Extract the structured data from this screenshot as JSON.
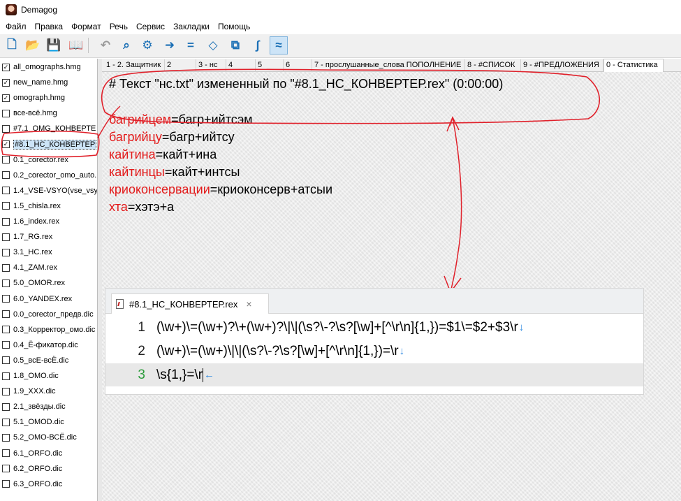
{
  "window": {
    "title": "Demagog"
  },
  "menu": [
    "Файл",
    "Правка",
    "Формат",
    "Речь",
    "Сервис",
    "Закладки",
    "Помощь"
  ],
  "toolbar": {
    "buttons": [
      {
        "name": "new-file-icon",
        "glyph": "🗋"
      },
      {
        "name": "open-folder-icon",
        "glyph": "📂"
      },
      {
        "name": "save-icon",
        "glyph": "💾"
      },
      {
        "name": "book-icon",
        "glyph": "📖"
      },
      {
        "name": "undo-icon",
        "glyph": "↶"
      },
      {
        "name": "binoculars-icon",
        "glyph": "⌕"
      },
      {
        "name": "gear-icon",
        "glyph": "⚙"
      },
      {
        "name": "arrow-right-icon",
        "glyph": "➜"
      },
      {
        "name": "equals-icon",
        "glyph": "="
      },
      {
        "name": "diamond-icon",
        "glyph": "◇"
      },
      {
        "name": "convert-icon",
        "glyph": "⧉"
      },
      {
        "name": "integral-icon",
        "glyph": "∫"
      },
      {
        "name": "approx-icon",
        "glyph": "≈"
      }
    ]
  },
  "sidebar": {
    "items": [
      {
        "label": "all_omographs.hmg",
        "checked": true
      },
      {
        "label": "new_name.hmg",
        "checked": true
      },
      {
        "label": "omograph.hmg",
        "checked": true
      },
      {
        "label": "все-всё.hmg",
        "checked": false
      },
      {
        "label": "#7.1_OMG_КОНВЕРТЕ",
        "checked": false
      },
      {
        "label": "#8.1_НС_КОНВЕРТЕР",
        "checked": true,
        "selected": true
      },
      {
        "label": "0.1_corector.rex",
        "checked": false
      },
      {
        "label": "0.2_corector_omo_auto.",
        "checked": false
      },
      {
        "label": "1.4_VSE-VSYO(vse_vsy",
        "checked": false
      },
      {
        "label": "1.5_chisla.rex",
        "checked": false
      },
      {
        "label": "1.6_index.rex",
        "checked": false
      },
      {
        "label": "1.7_RG.rex",
        "checked": false
      },
      {
        "label": "3.1_НС.rex",
        "checked": false
      },
      {
        "label": "4.1_ZAM.rex",
        "checked": false
      },
      {
        "label": "5.0_OMOR.rex",
        "checked": false
      },
      {
        "label": "6.0_YANDEX.rex",
        "checked": false
      },
      {
        "label": "0.0_corector_предв.dic",
        "checked": false
      },
      {
        "label": "0.3_Корректор_омо.dic",
        "checked": false
      },
      {
        "label": "0.4_Ё-фикатор.dic",
        "checked": false
      },
      {
        "label": "0.5_всЕ-всЁ.dic",
        "checked": false
      },
      {
        "label": "1.8_OMO.dic",
        "checked": false
      },
      {
        "label": "1.9_XXX.dic",
        "checked": false
      },
      {
        "label": "2.1_звёзды.dic",
        "checked": false
      },
      {
        "label": "5.1_OMOD.dic",
        "checked": false
      },
      {
        "label": "5.2_OMO-ВСЁ.dic",
        "checked": false
      },
      {
        "label": "6.1_ORFO.dic",
        "checked": false
      },
      {
        "label": "6.2_ORFO.dic",
        "checked": false
      },
      {
        "label": "6.3_ORFO.dic",
        "checked": false
      }
    ]
  },
  "tabs": [
    {
      "label": "1 - 2. Защитник"
    },
    {
      "label": "2"
    },
    {
      "label": "3 - нс"
    },
    {
      "label": "4"
    },
    {
      "label": "5"
    },
    {
      "label": "6"
    },
    {
      "label": "7 - прослушанные_слова ПОПОЛНЕНИЕ"
    },
    {
      "label": "8 - #СПИСОК"
    },
    {
      "label": "9 - #ПРЕДЛОЖЕНИЯ"
    },
    {
      "label": "0 - Статистика",
      "active": true
    }
  ],
  "report": {
    "header": "# Текст \"нс.txt\" измененный по \"#8.1_НС_КОНВЕРТЕР.rex\" (0:00:00)",
    "entries": [
      {
        "word": "багрийцем",
        "rest": "=багр+ийтсэм"
      },
      {
        "word": "багрийцу",
        "rest": "=багр+ийтсу"
      },
      {
        "word": "кайтина",
        "rest": "=кайт+ина"
      },
      {
        "word": "кайтинцы",
        "rest": "=кайт+интсы"
      },
      {
        "word": "криоконсервации",
        "rest": "=криоконсерв+атсыи"
      },
      {
        "word": "хта",
        "rest": "=хэтэ+а"
      }
    ]
  },
  "editor": {
    "tab_label": "#8.1_НС_КОНВЕРТЕР.rex",
    "close_glyph": "×",
    "lines": [
      {
        "num": "1",
        "code": "(\\w+)\\=(\\w+)?\\+(\\w+)?\\|\\|(\\s?\\-?\\s?[\\w]+[^\\r\\n]{1,})=$1\\=$2+$3\\r",
        "eol": "↓"
      },
      {
        "num": "2",
        "code": "(\\w+)\\=(\\w+)\\|\\|(\\s?\\-?\\s?[\\w]+[^\\r\\n]{1,})=\\r",
        "eol": "↓"
      },
      {
        "num": "3",
        "code": "\\s{1,}=\\r",
        "eol": "←",
        "current": true
      }
    ]
  },
  "colors": {
    "highlight_word": "#e31b1b",
    "annotation": "#e0202a",
    "eol_marker": "#2b88e0"
  }
}
